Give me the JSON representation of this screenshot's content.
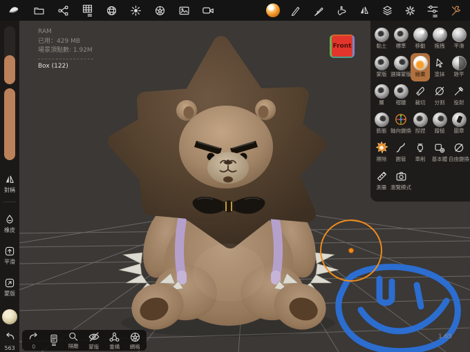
{
  "app": {
    "viewport_bg": "#3b3835",
    "topbar_bg": "#141414",
    "panel_bg": "#1e1c1a",
    "sidebar_bg": "#1b1918",
    "accent_orange": "#e8871e",
    "selected_tool_bg": "#b0713f",
    "smiley_blue": "#2c6fd6",
    "slider_fill": "#bb815a"
  },
  "top_toolbar": {
    "left_icons": [
      {
        "name": "app-logo-icon"
      },
      {
        "name": "folder-icon"
      },
      {
        "name": "node-graph-icon"
      },
      {
        "name": "topology-grid-icon"
      },
      {
        "name": "material-sphere-icon"
      },
      {
        "name": "light-icon"
      },
      {
        "name": "environment-icon"
      },
      {
        "name": "image-icon"
      },
      {
        "name": "camera-icon"
      }
    ],
    "right_icons": [
      {
        "name": "matcap-sphere-icon"
      },
      {
        "name": "pen-icon"
      },
      {
        "name": "paint-brush-icon"
      },
      {
        "name": "smudge-hand-icon"
      },
      {
        "name": "symmetry-icon"
      },
      {
        "name": "layers-icon"
      },
      {
        "name": "settings-gear-icon"
      },
      {
        "name": "sliders-icon"
      },
      {
        "name": "tools-wrench-icon"
      }
    ]
  },
  "stats": {
    "ram_label": "RAM",
    "ram_used": "已用：429 MB",
    "scene_vertices": "場景頂點數: 1.92M",
    "selected_object": "Box (122)"
  },
  "view_cube": {
    "front_label": "Front"
  },
  "left_sidebar": {
    "tools": [
      {
        "label": "對稱",
        "icon": "symmetry-icon"
      },
      {
        "label": "橡皮",
        "icon": "eraser-drop-icon"
      },
      {
        "label": "平滑",
        "icon": "smooth-box-icon"
      },
      {
        "label": "蒙版",
        "icon": "mask-box-icon"
      }
    ],
    "undo_count": "563"
  },
  "tool_panel": {
    "tools": [
      {
        "label": "黏土",
        "icon": "sphere-clay"
      },
      {
        "label": "標準",
        "icon": "sphere-standard"
      },
      {
        "label": "移動",
        "icon": "sphere-move"
      },
      {
        "label": "拖拽",
        "icon": "sphere-drag"
      },
      {
        "label": "平滑",
        "icon": "sphere-rough"
      },
      {
        "label": "蒙版",
        "icon": "sphere-mask"
      },
      {
        "label": "選擇蒙版",
        "icon": "sphere-selmask"
      },
      {
        "label": "繪畫",
        "icon": "sphere-paint",
        "selected": true
      },
      {
        "label": "塗抹",
        "icon": "cursor-glyph"
      },
      {
        "label": "銼平",
        "icon": "sphere-flatten"
      },
      {
        "label": "層",
        "icon": "sphere-layer"
      },
      {
        "label": "褶皺",
        "icon": "sphere-crease"
      },
      {
        "label": "裁切",
        "icon": "knife-glyph"
      },
      {
        "label": "分割",
        "icon": "knife-slash-glyph"
      },
      {
        "label": "投射",
        "icon": "knife-cross-glyph"
      },
      {
        "label": "膨脹",
        "icon": "sphere-inflate"
      },
      {
        "label": "軸向變換",
        "icon": "gizmo-glyph"
      },
      {
        "label": "揑捏",
        "icon": "sphere-pinch"
      },
      {
        "label": "蹭槌",
        "icon": "sphere-nudge"
      },
      {
        "label": "圖章",
        "icon": "sphere-stamp"
      },
      {
        "label": "擦除",
        "icon": "erase-splat-glyph"
      },
      {
        "label": "圓管",
        "icon": "tube-glyph"
      },
      {
        "label": "車削",
        "icon": "lathe-glyph"
      },
      {
        "label": "基本體",
        "icon": "primitive-glyph"
      },
      {
        "label": "自由變換",
        "icon": "freeform-glyph"
      },
      {
        "label": "測量",
        "icon": "ruler-glyph"
      },
      {
        "label": "瀏覽模式",
        "icon": "viewmode-glyph"
      }
    ]
  },
  "bottom_toolbar": {
    "redo_count": "0",
    "items": [
      {
        "label": "",
        "icon": "redo-icon"
      },
      {
        "label": "",
        "icon": "history-panel-icon"
      },
      {
        "label": "隔離",
        "icon": "isolate-icon"
      },
      {
        "label": "蒙版",
        "icon": "mask-hidden-icon"
      },
      {
        "label": "重構",
        "icon": "remesh-icon"
      },
      {
        "label": "網格",
        "icon": "wireframe-icon"
      }
    ]
  },
  "viewport": {
    "scale_label": "1.65"
  }
}
